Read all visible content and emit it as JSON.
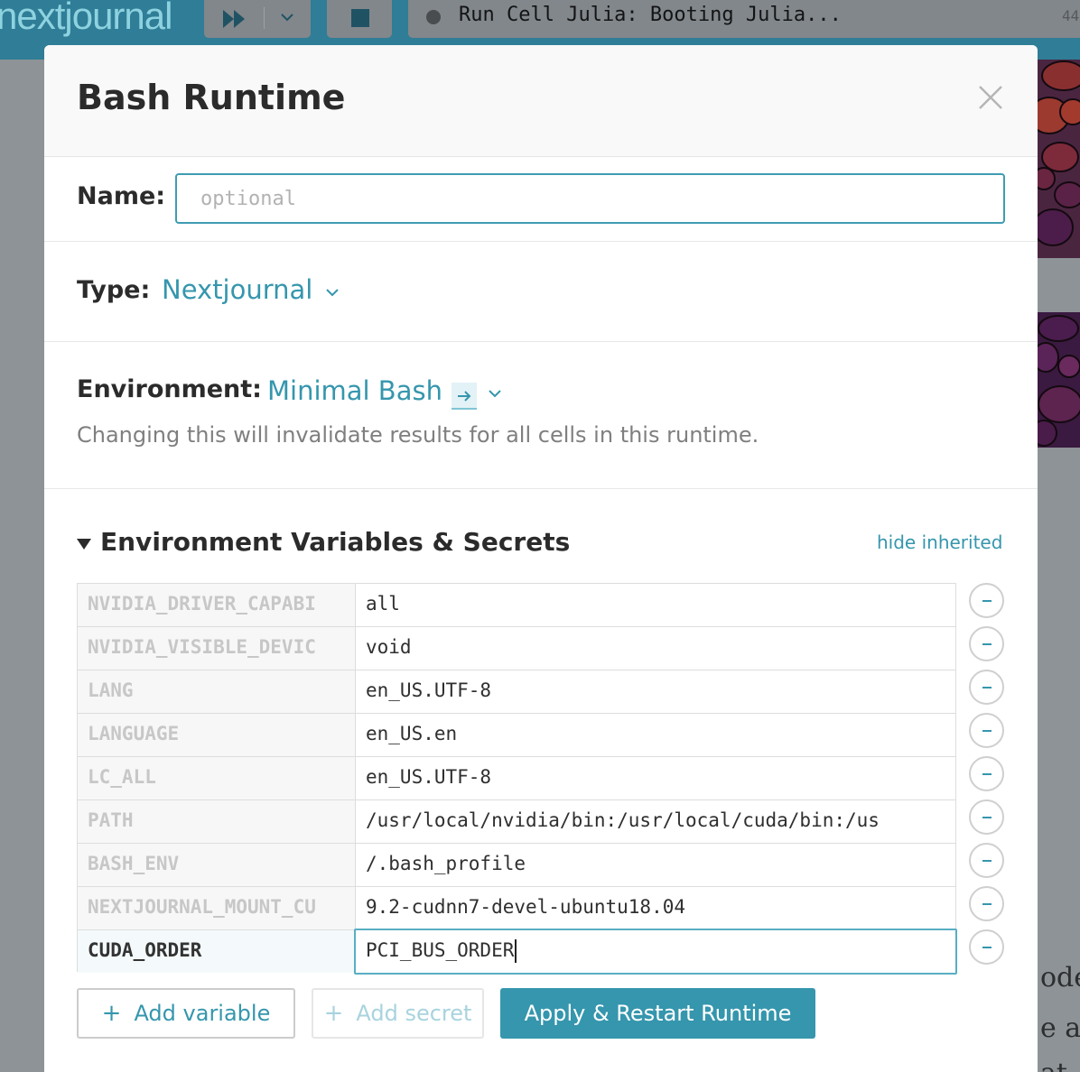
{
  "app": {
    "logo_text": "nextjournal",
    "status_text": "Run Cell Julia: Booting Julia...",
    "status_count": "44",
    "background_text": [
      "ode",
      "e al",
      "at"
    ]
  },
  "modal": {
    "title": "Bash Runtime",
    "name": {
      "label": "Name:",
      "placeholder": "optional",
      "value": ""
    },
    "type": {
      "label": "Type:",
      "value": "Nextjournal"
    },
    "environment": {
      "label": "Environment:",
      "value": "Minimal Bash",
      "hint": "Changing this will invalidate results for all cells in this runtime."
    },
    "env_vars": {
      "heading": "Environment Variables & Secrets",
      "hide_inherited": "hide inherited",
      "rows": [
        {
          "key": "NVIDIA_DRIVER_CAPABI",
          "value": "all"
        },
        {
          "key": "NVIDIA_VISIBLE_DEVIC",
          "value": "void"
        },
        {
          "key": "LANG",
          "value": "en_US.UTF-8"
        },
        {
          "key": "LANGUAGE",
          "value": "en_US.en"
        },
        {
          "key": "LC_ALL",
          "value": "en_US.UTF-8"
        },
        {
          "key": "PATH",
          "value": "/usr/local/nvidia/bin:/usr/local/cuda/bin:/us"
        },
        {
          "key": "BASH_ENV",
          "value": "/.bash_profile"
        },
        {
          "key": "NEXTJOURNAL_MOUNT_CU",
          "value": "9.2-cudnn7-devel-ubuntu18.04"
        },
        {
          "key": "CUDA_ORDER",
          "value": "PCI_BUS_ORDER"
        }
      ]
    },
    "buttons": {
      "add_variable": "Add variable",
      "add_secret": "Add secret",
      "apply": "Apply & Restart Runtime",
      "plus": "+"
    }
  },
  "colors": {
    "accent": "#3596ad",
    "topbar": "#2f7d96",
    "overlay": "#8e9397"
  }
}
